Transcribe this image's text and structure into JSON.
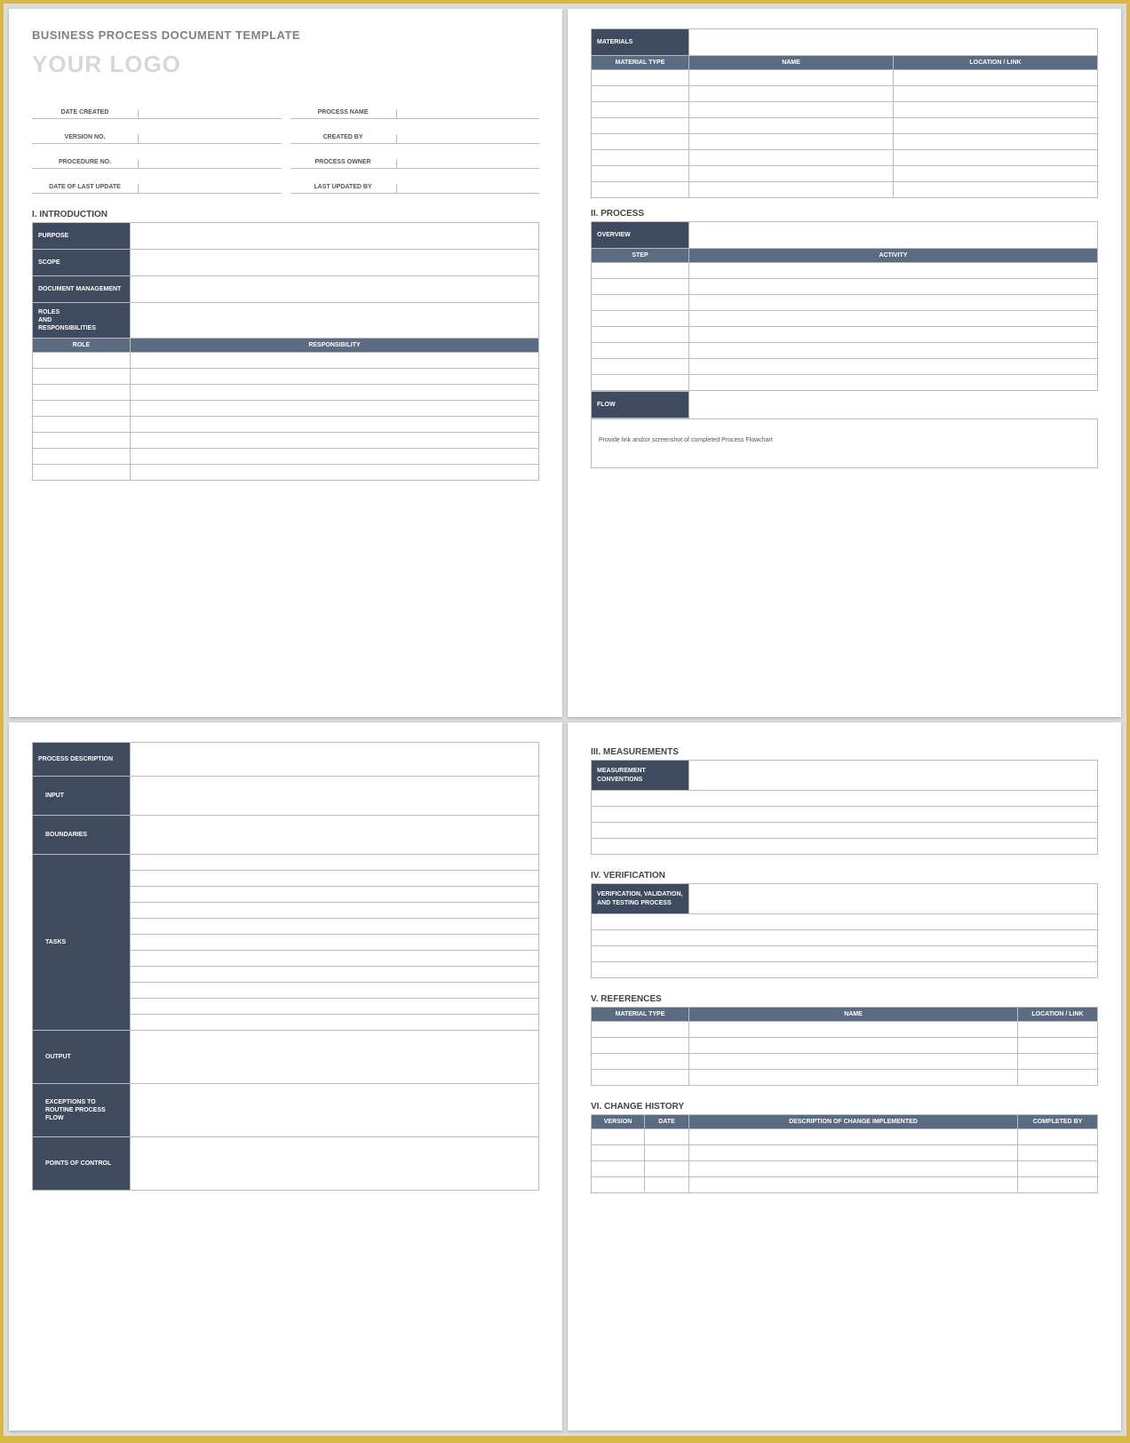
{
  "doc_title": "BUSINESS PROCESS DOCUMENT TEMPLATE",
  "logo_placeholder": "YOUR LOGO",
  "meta": {
    "date_created": "DATE CREATED",
    "process_name": "PROCESS NAME",
    "version_no": "VERSION NO.",
    "created_by": "CREATED BY",
    "procedure_no": "PROCEDURE NO.",
    "process_owner": "PROCESS OWNER",
    "date_last_update": "DATE OF LAST UPDATE",
    "last_updated_by": "LAST UPDATED BY"
  },
  "sec1": {
    "heading": "I.   INTRODUCTION",
    "purpose": "PURPOSE",
    "scope": "SCOPE",
    "doc_mgmt": "DOCUMENT MANAGEMENT",
    "roles_resp": "ROLES\nAND\nRESPONSIBILITIES",
    "role_col": "ROLE",
    "responsibility_col": "RESPONSIBILITY"
  },
  "materials": {
    "heading": "MATERIALS",
    "col_type": "MATERIAL TYPE",
    "col_name": "NAME",
    "col_loc": "LOCATION / LINK"
  },
  "sec2": {
    "heading": "II.  PROCESS",
    "overview": "OVERVIEW",
    "step_col": "STEP",
    "activity_col": "ACTIVITY",
    "flow": "FLOW",
    "flow_note": "Provide link and/or screenshot of completed Process Flowchart"
  },
  "page3": {
    "process_desc": "PROCESS DESCRIPTION",
    "input": "INPUT",
    "boundaries": "BOUNDARIES",
    "tasks": "TASKS",
    "output": "OUTPUT",
    "exceptions": "EXCEPTIONS TO ROUTINE PROCESS FLOW",
    "points_of_control": "POINTS OF CONTROL"
  },
  "sec3": {
    "heading": "III. MEASUREMENTS",
    "measurement_conventions": "MEASUREMENT CONVENTIONS"
  },
  "sec4": {
    "heading": "IV. VERIFICATION",
    "verification": "VERIFICATION, VALIDATION, AND TESTING PROCESS"
  },
  "sec5": {
    "heading": "V.  REFERENCES",
    "col_type": "MATERIAL TYPE",
    "col_name": "NAME",
    "col_loc": "LOCATION / LINK"
  },
  "sec6": {
    "heading": "VI. CHANGE HISTORY",
    "col_version": "VERSION",
    "col_date": "DATE",
    "col_desc": "DESCRIPTION OF CHANGE IMPLEMENTED",
    "col_completed": "COMPLETED BY"
  }
}
